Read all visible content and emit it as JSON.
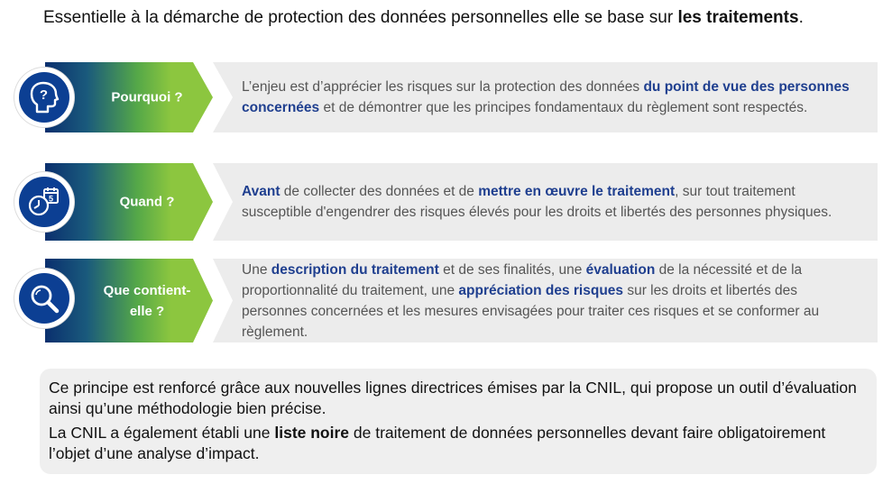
{
  "intro": {
    "text": "Essentielle à la démarche de protection des données personnelles elle se base sur ",
    "bold": "les traitements",
    "end": "."
  },
  "rows": [
    {
      "label": "Pourquoi ?",
      "icon": "head-question-icon",
      "parts": [
        {
          "t": "L’enjeu est d’apprécier les risques sur la protection des données ",
          "b": false
        },
        {
          "t": "du point de vue des personnes concernées",
          "b": true
        },
        {
          "t": " et de démontrer que les principes fondamentaux du règlement sont respectés.",
          "b": false
        }
      ]
    },
    {
      "label": "Quand ?",
      "icon": "clock-calendar-icon",
      "parts": [
        {
          "t": "Avant",
          "b": true
        },
        {
          "t": " de collecter des données et de ",
          "b": false
        },
        {
          "t": "mettre en œuvre le traitement",
          "b": true
        },
        {
          "t": ", sur tout traitement susceptible d'engendrer des risques élevés pour les droits et libertés des personnes physiques.",
          "b": false
        }
      ]
    },
    {
      "label": "Que contient-elle ?",
      "icon": "magnifier-icon",
      "parts": [
        {
          "t": "Une ",
          "b": false
        },
        {
          "t": "description du traitement",
          "b": true
        },
        {
          "t": " et de ses finalités, une ",
          "b": false
        },
        {
          "t": "évaluation",
          "b": true
        },
        {
          "t": " de la nécessité et de la proportionnalité du traitement, une ",
          "b": false
        },
        {
          "t": "appréciation des risques",
          "b": true
        },
        {
          "t": " sur les droits et libertés des personnes concernées et les mesures envisagées pour traiter ces risques et se conformer au règlement.",
          "b": false
        }
      ]
    }
  ],
  "summary": {
    "line1": "Ce principe est renforcé grâce aux nouvelles lignes directrices émises par la CNIL, qui propose un outil d’évaluation ainsi qu’une méthodologie bien précise.",
    "line2_a": "La CNIL a également établi une ",
    "line2_bold": "liste noire",
    "line2_b": " de traitement de données personnelles devant faire obligatoirement l’objet d’une analyse d’impact."
  },
  "colors": {
    "navy": "#0c3f93",
    "green": "#8cc63f",
    "highlight": "#1f3f8f",
    "panel": "#ececec"
  }
}
